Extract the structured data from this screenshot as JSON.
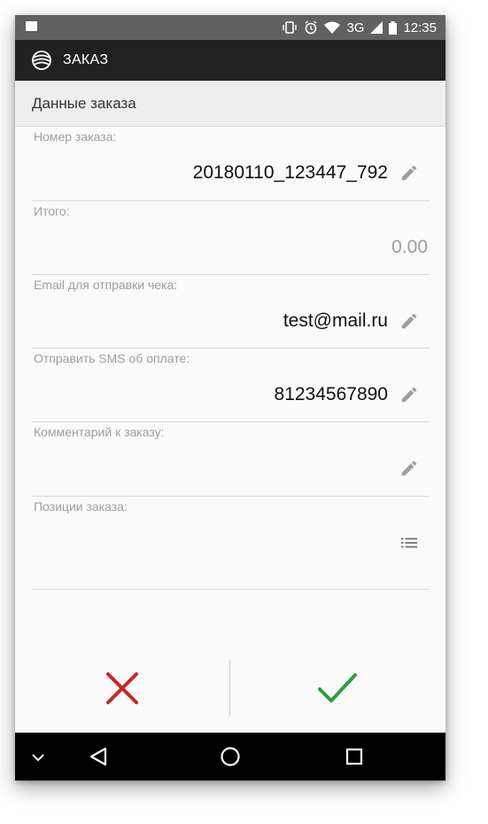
{
  "status_bar": {
    "network": "3G",
    "time": "12:35",
    "icons": [
      "image-icon",
      "vibrate-icon",
      "alarm-icon",
      "wifi-icon",
      "signal-icon",
      "battery-icon"
    ]
  },
  "app_bar": {
    "title": "ЗАКАЗ",
    "logo": "app-logo-icon"
  },
  "section": {
    "title": "Данные заказа"
  },
  "fields": {
    "order_number": {
      "label": "Номер заказа:",
      "value": "20180110_123447_792"
    },
    "total": {
      "label": "Итого:",
      "value": "0.00"
    },
    "email": {
      "label": "Email для отправки чека:",
      "value": "test@mail.ru"
    },
    "sms": {
      "label": "Отправить SMS об оплате:",
      "value": "81234567890"
    },
    "comment": {
      "label": "Комментарий к заказу:",
      "value": ""
    },
    "positions": {
      "label": "Позиции заказа:"
    }
  },
  "actions": {
    "cancel_icon": "cancel-icon",
    "confirm_icon": "checkmark-icon",
    "cancel_color": "#c62828",
    "confirm_color": "#2e9e3a"
  },
  "nav_bar": {
    "icons": [
      "chevron-down-icon",
      "back-icon",
      "home-icon",
      "recents-icon"
    ]
  },
  "colors": {
    "status_bar": "#616161",
    "app_bar": "#212121",
    "background": "#fafafa",
    "edit_icon": "#9e9e9e"
  }
}
